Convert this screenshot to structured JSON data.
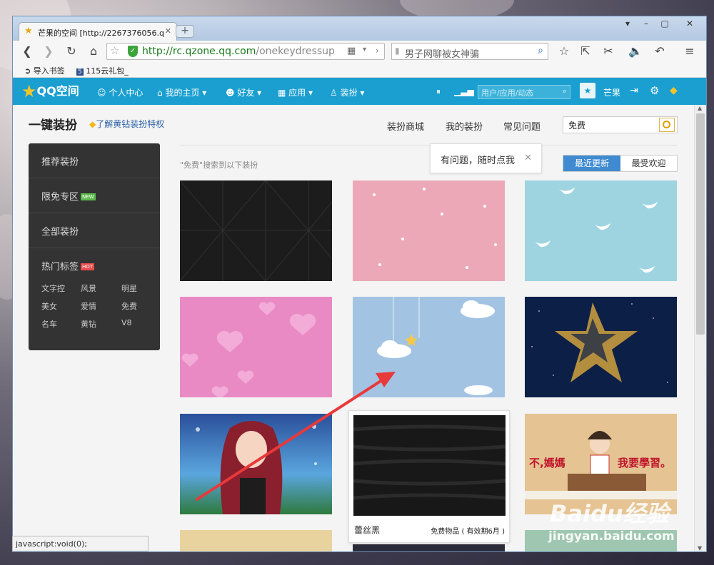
{
  "browser": {
    "tab_title": "芒果的空间 [http://2267376056.q",
    "url_host": "http://rc.qzone.qq.com",
    "url_path": "/onekeydressup",
    "search_text": "男子网聊被女神骗",
    "bookmarks": [
      "导入书签",
      "115云礼包_"
    ],
    "status_text": "javascript:void(0);"
  },
  "qzone_nav": {
    "logo": "QQ空间",
    "items": [
      "个人中心",
      "我的主页",
      "好友",
      "应用",
      "装扮"
    ],
    "search_placeholder": "用户/应用/动态",
    "user_name": "芒果"
  },
  "page": {
    "title": "一键装扮",
    "privilege_link": "了解黄钻装扮特权",
    "top_links": [
      "装扮商城",
      "我的装扮",
      "常见问题"
    ],
    "search_value": "免费",
    "tip_text": "有问题，随时点我",
    "search_result_text": "\"免费\"搜索到以下装扮",
    "sort": {
      "active": "最近更新",
      "inactive": "最受欢迎"
    }
  },
  "sidebar": {
    "items": [
      {
        "label": "推荐装扮"
      },
      {
        "label": "限免专区",
        "badge": "NEW"
      },
      {
        "label": "全部装扮"
      },
      {
        "label": "热门标签",
        "badge": "HOT"
      }
    ],
    "tags": [
      "文字控",
      "风景",
      "明星",
      "美女",
      "爱情",
      "免费",
      "名车",
      "黄钻",
      "V8"
    ]
  },
  "hover_card": {
    "name": "蕾丝黑",
    "info": "免费物品 ( 有效期6月 )"
  },
  "card_images": {
    "happy_girl_left": "不,媽媽",
    "happy_girl_right": "我要學習。"
  },
  "watermark": {
    "brand": "Baidu经验",
    "url": "jingyan.baidu.com"
  }
}
